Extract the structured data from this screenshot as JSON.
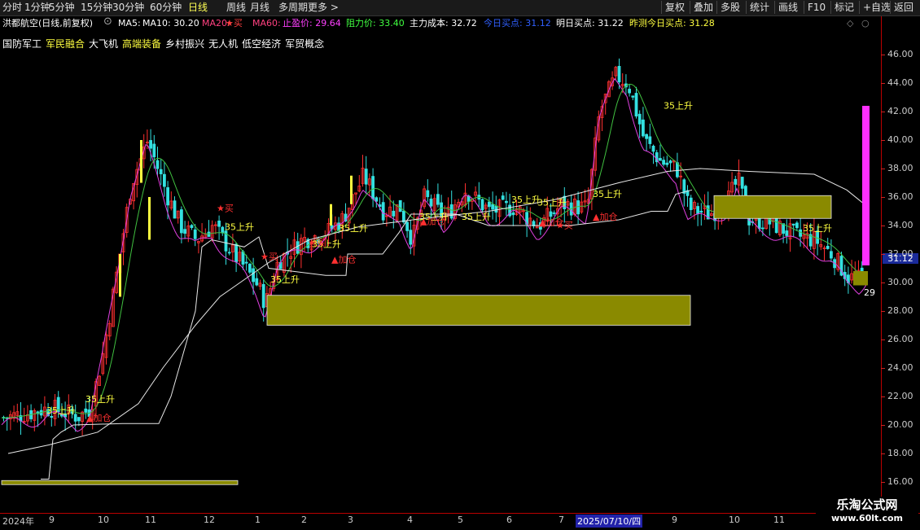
{
  "toolbar": {
    "left": [
      "分时",
      "1分钟",
      "5分钟",
      "15分钟",
      "30分钟",
      "60分钟",
      "日线",
      "周线",
      "月线",
      "多周期",
      "更多 >"
    ],
    "active": "日线",
    "right": [
      "复权",
      "叠加",
      "多股",
      "统计",
      "画线",
      "F10",
      "标记",
      "+自选",
      "返回"
    ]
  },
  "info": {
    "stock": "洪都航空(日线,前复权)",
    "ma5": "MA5:",
    "ma10": "MA10: 30.20",
    "ma20": "MA20:",
    "buy_mark": "★买",
    "ma60": "MA60:",
    "stop_profit": "止盈价: 29.64",
    "resistance": "阻力价: 33.40",
    "main_cost": "主力成本: 32.72",
    "today_buy": "今日买点: 31.12",
    "tomorrow_buy": "明日买点: 31.22",
    "predict_buy": "昨测今日买点: 31.28"
  },
  "concepts": [
    "国防军工",
    "军民融合",
    "大飞机",
    "高端装备",
    "乡村振兴",
    "无人机",
    "低空经济",
    "军贸概念"
  ],
  "price_axis": [
    "46.00",
    "44.00",
    "42.00",
    "40.00",
    "38.00",
    "36.00",
    "34.00",
    "32.00",
    "30.00",
    "28.00",
    "26.00",
    "24.00",
    "22.00",
    "20.00",
    "18.00",
    "16.00"
  ],
  "current_price": "31.12",
  "low_label": "29",
  "date_axis": {
    "labels": [
      "2024年",
      "9",
      "10",
      "11",
      "12",
      "1",
      "2",
      "3",
      "4",
      "5",
      "6",
      "7",
      "2025/07/10/四",
      "9",
      "10",
      "11"
    ],
    "selected": "2025/07/10/四"
  },
  "annotations": {
    "rise": "35上升",
    "add": "▲加仓",
    "buy": "★买"
  },
  "watermark": {
    "title": "乐淘公式网",
    "url": "www.60lt.com"
  },
  "colors": {
    "up": "#ff3030",
    "down": "#33e0e0",
    "ma_magenta": "#e040e0",
    "ma_green": "#40c040",
    "ma_white": "#e8e8e8",
    "box": "#8a8a00",
    "axis": "#cc2020"
  }
}
